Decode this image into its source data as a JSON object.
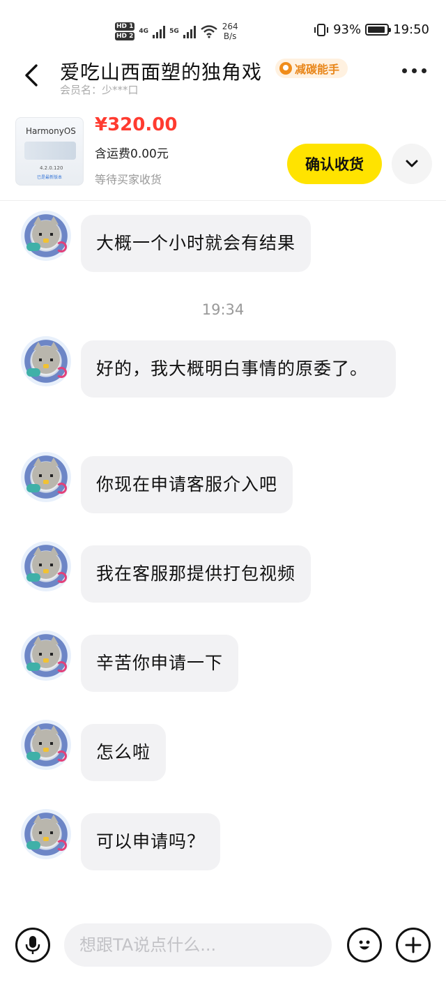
{
  "status_bar": {
    "hd1": "HD 1",
    "hd2": "HD 2",
    "net1": "4G",
    "net2": "5G",
    "speed_value": "264",
    "speed_unit": "B/s",
    "battery": "93%",
    "battery_level": 0.93,
    "time": "19:50"
  },
  "header": {
    "title": "爱吃山西面塑的独角戏",
    "badge": "减碳能手",
    "member": "会员名：少***口"
  },
  "product": {
    "thumb_os": "HarmonyOS",
    "thumb_version": "4.2.0.120",
    "thumb_sub": "已是最新版本",
    "price": "¥320.00",
    "shipping": "含运费0.00元",
    "status": "等待买家收货",
    "confirm_label": "确认收货"
  },
  "chat": {
    "time": "19:34",
    "messages": [
      "大概一个小时就会有结果",
      "好的，我大概明白事情的原委了。",
      "你现在申请客服介入吧",
      "我在客服那提供打包视频",
      "辛苦你申请一下",
      "怎么啦",
      "可以申请吗？"
    ]
  },
  "input": {
    "placeholder": "想跟TA说点什么..."
  },
  "icons": {
    "back": "chevron-left-icon",
    "more": "more-dots-icon",
    "expand": "chevron-down-icon",
    "mic": "mic-icon",
    "emoji": "emoji-icon",
    "plus": "plus-icon"
  },
  "colors": {
    "accent_button": "#ffe300",
    "price": "#ff3b30",
    "bubble": "#f2f2f4",
    "badge_text": "#e8861a"
  }
}
